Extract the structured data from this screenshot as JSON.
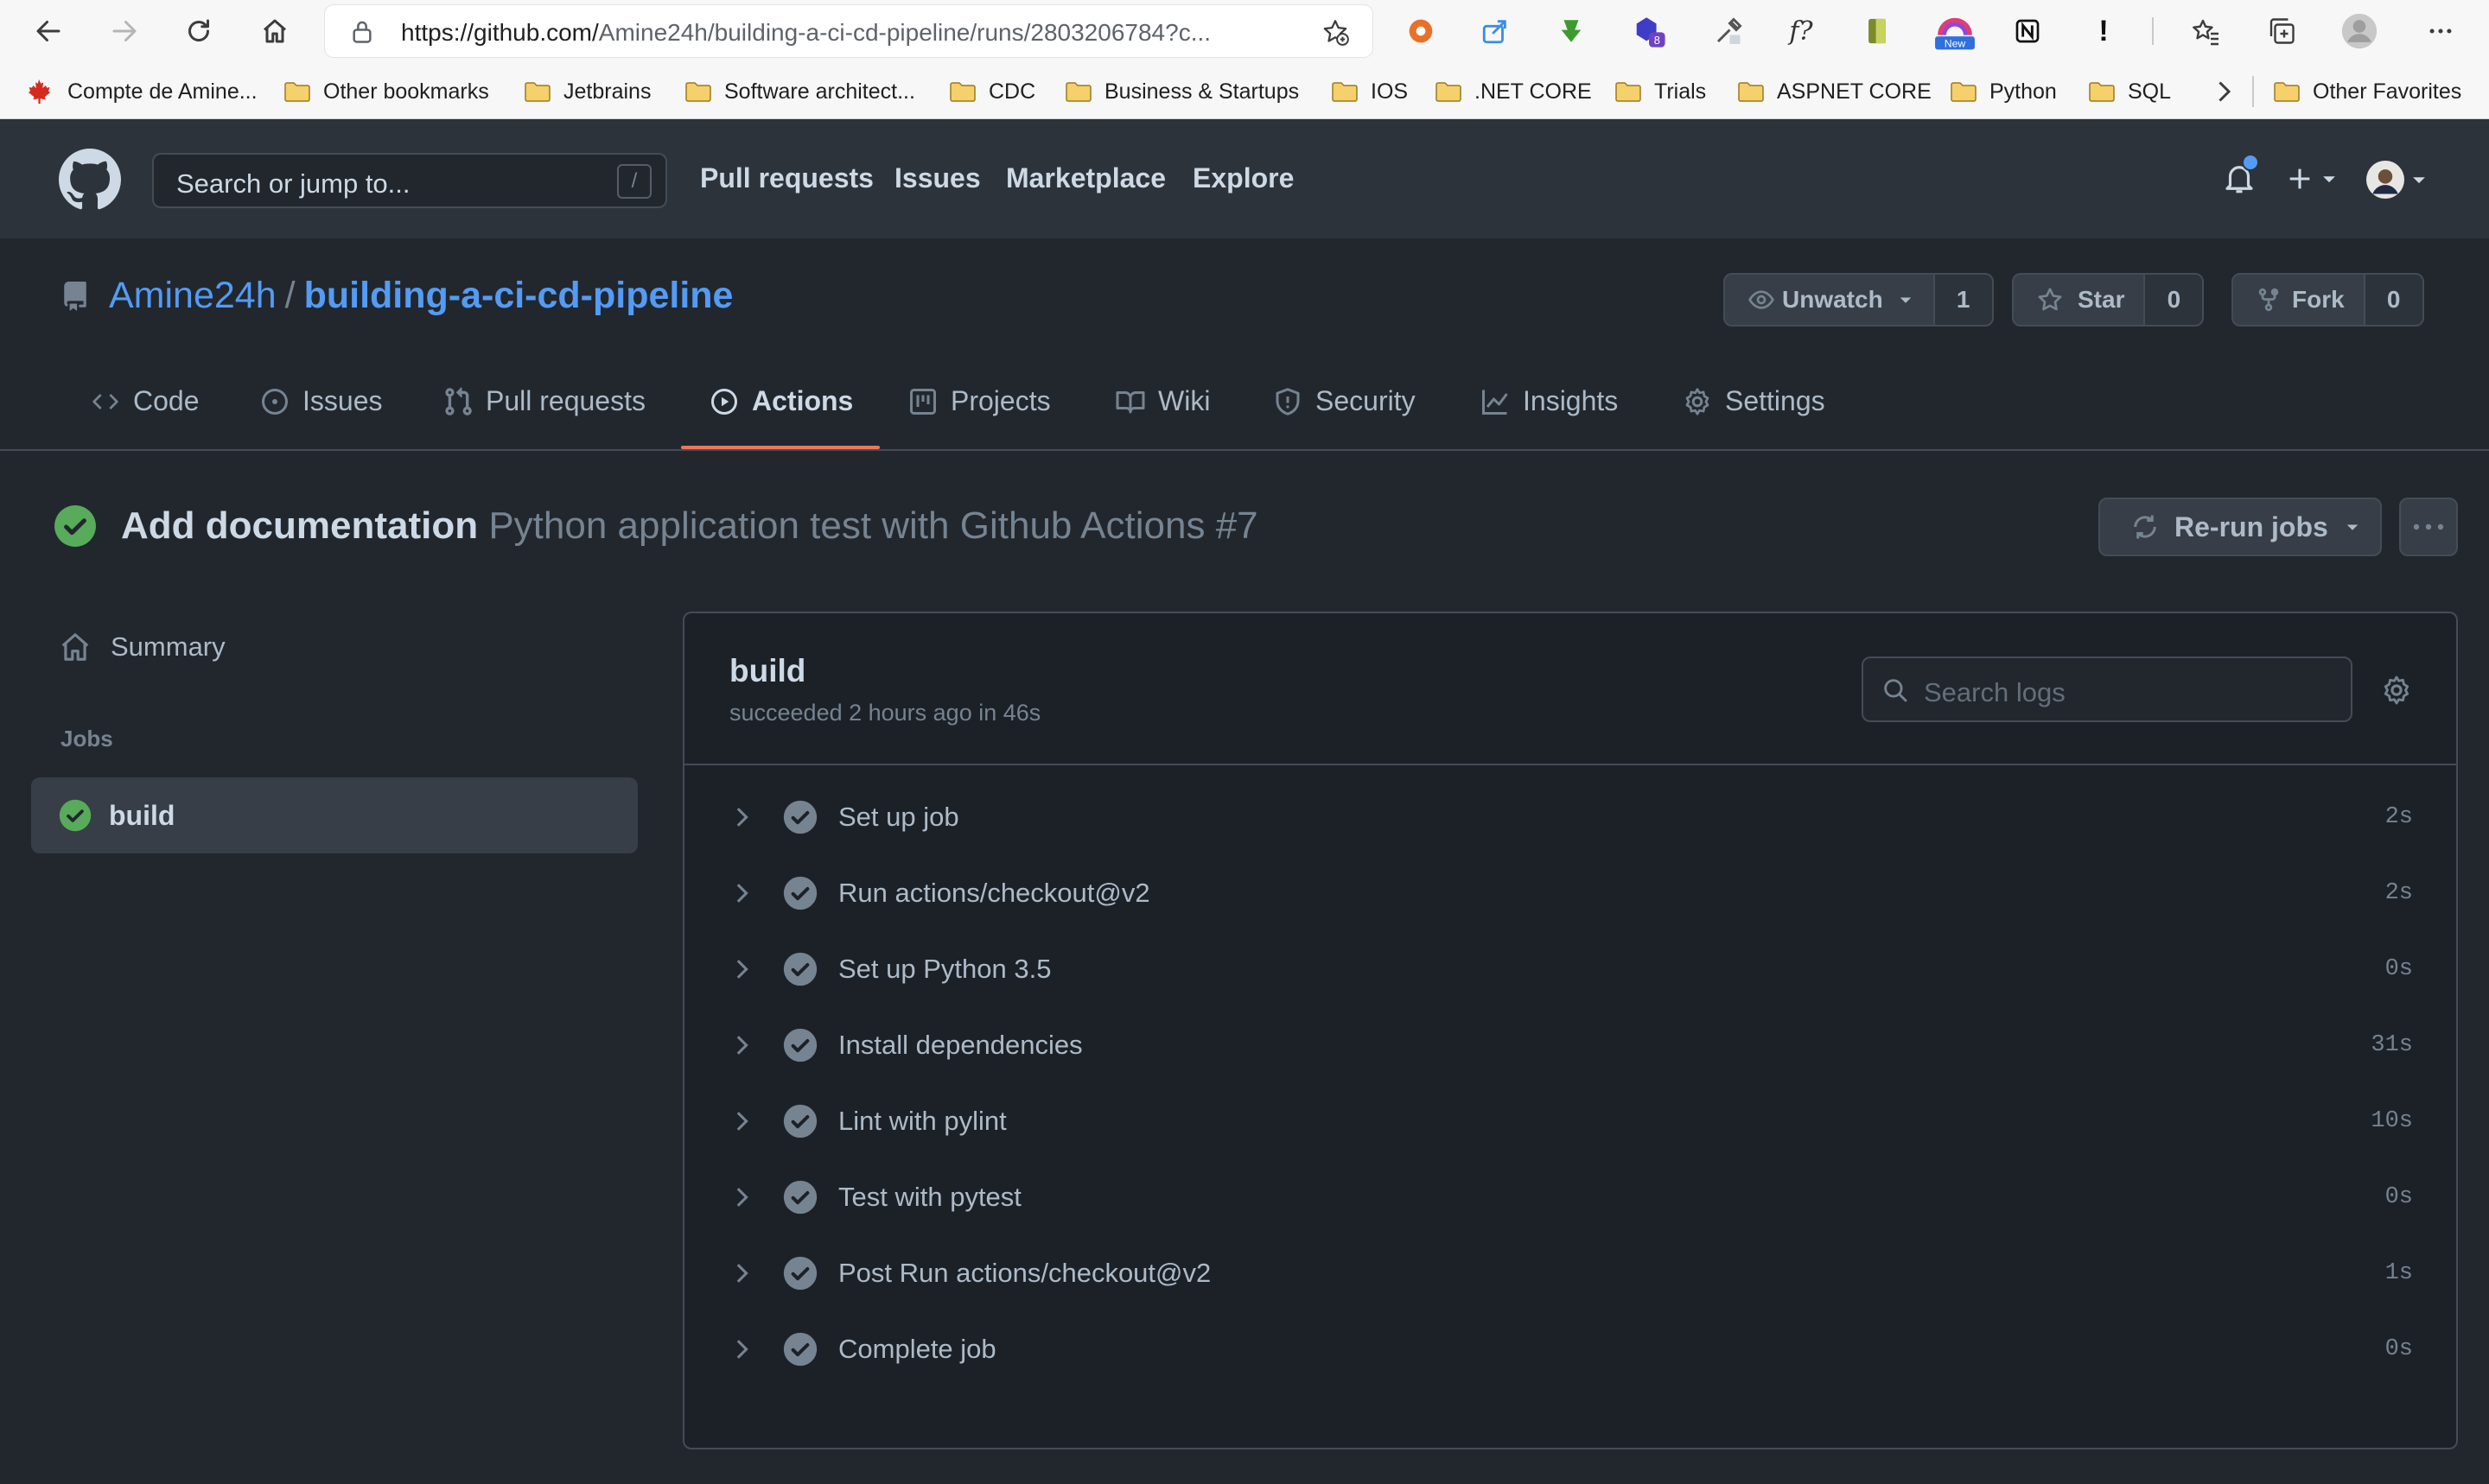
{
  "browser": {
    "url_host": "https://github.com/",
    "url_path": "Amine24h/building-a-ci-cd-pipeline/runs/2803206784?c...",
    "extension_badges": {
      "eight": "8",
      "new": "New"
    },
    "extension_glyphs": {
      "formula": "f?",
      "exclaim": "!"
    },
    "bookmarks": [
      "Compte de Amine...",
      "Other bookmarks",
      "Jetbrains",
      "Software architect...",
      "CDC",
      "Business & Startups",
      "IOS",
      ".NET CORE",
      "Trials",
      "ASPNET CORE",
      "Python",
      "SQL",
      "Other Favorites"
    ]
  },
  "header": {
    "search_placeholder": "Search or jump to...",
    "search_shortcut": "/",
    "nav": [
      "Pull requests",
      "Issues",
      "Marketplace",
      "Explore"
    ]
  },
  "repo": {
    "owner": "Amine24h",
    "separator": "/",
    "name": "building-a-ci-cd-pipeline",
    "watch_label": "Unwatch",
    "watch_count": "1",
    "star_label": "Star",
    "star_count": "0",
    "fork_label": "Fork",
    "fork_count": "0"
  },
  "tabs": [
    {
      "label": "Code",
      "icon": "code-icon"
    },
    {
      "label": "Issues",
      "icon": "issue-opened-icon"
    },
    {
      "label": "Pull requests",
      "icon": "git-pull-request-icon"
    },
    {
      "label": "Actions",
      "icon": "play-icon",
      "selected": true
    },
    {
      "label": "Projects",
      "icon": "project-icon"
    },
    {
      "label": "Wiki",
      "icon": "book-icon"
    },
    {
      "label": "Security",
      "icon": "shield-icon"
    },
    {
      "label": "Insights",
      "icon": "graph-icon"
    },
    {
      "label": "Settings",
      "icon": "gear-icon"
    }
  ],
  "run": {
    "commit_message": "Add documentation",
    "workflow_name": "Python application test with Github Actions #7",
    "rerun_label": "Re-run jobs"
  },
  "sidebar": {
    "summary_label": "Summary",
    "jobs_heading": "Jobs",
    "job_name": "build"
  },
  "log": {
    "job_name": "build",
    "status_text": "succeeded 2 hours ago in 46s",
    "search_placeholder": "Search logs",
    "steps": [
      {
        "name": "Set up job",
        "duration": "2s"
      },
      {
        "name": "Run actions/checkout@v2",
        "duration": "2s"
      },
      {
        "name": "Set up Python 3.5",
        "duration": "0s"
      },
      {
        "name": "Install dependencies",
        "duration": "31s"
      },
      {
        "name": "Lint with pylint",
        "duration": "10s"
      },
      {
        "name": "Test with pytest",
        "duration": "0s"
      },
      {
        "name": "Post Run actions/checkout@v2",
        "duration": "1s"
      },
      {
        "name": "Complete job",
        "duration": "0s"
      }
    ]
  },
  "colors": {
    "background": "#22272e",
    "header": "#2d333b",
    "link": "#539bf5",
    "success": "#57ab5a",
    "tab_underline": "#ec775c"
  }
}
